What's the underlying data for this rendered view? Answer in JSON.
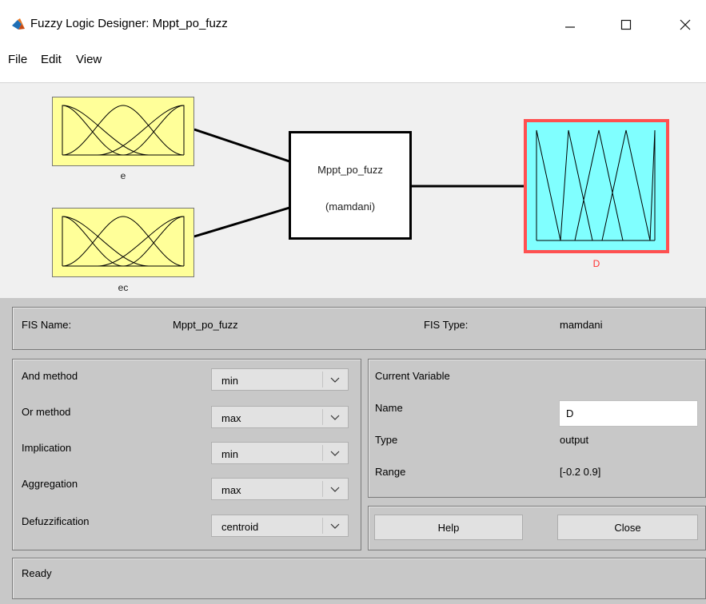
{
  "window": {
    "title": "Fuzzy Logic Designer: Mppt_po_fuzz"
  },
  "menu": [
    "File",
    "Edit",
    "View"
  ],
  "diagram": {
    "inputs": [
      "e",
      "ec"
    ],
    "system_name": "Mppt_po_fuzz",
    "system_type": "(mamdani)",
    "output": "D",
    "colors": {
      "input_box": "#ffff99",
      "output_box": "#80ffff",
      "selected_border": "#ff5050"
    }
  },
  "info": {
    "fis_name_label": "FIS Name:",
    "fis_name_value": "Mppt_po_fuzz",
    "fis_type_label": "FIS Type:",
    "fis_type_value": "mamdani"
  },
  "methods": [
    {
      "label": "And method",
      "value": "min"
    },
    {
      "label": "Or method",
      "value": "max"
    },
    {
      "label": "Implication",
      "value": "min"
    },
    {
      "label": "Aggregation",
      "value": "max"
    },
    {
      "label": "Defuzzification",
      "value": "centroid"
    }
  ],
  "current_variable": {
    "heading": "Current Variable",
    "name_label": "Name",
    "name_value": "D",
    "type_label": "Type",
    "type_value": "output",
    "range_label": "Range",
    "range_value": "[-0.2 0.9]"
  },
  "buttons": {
    "help": "Help",
    "close": "Close"
  },
  "status": "Ready"
}
